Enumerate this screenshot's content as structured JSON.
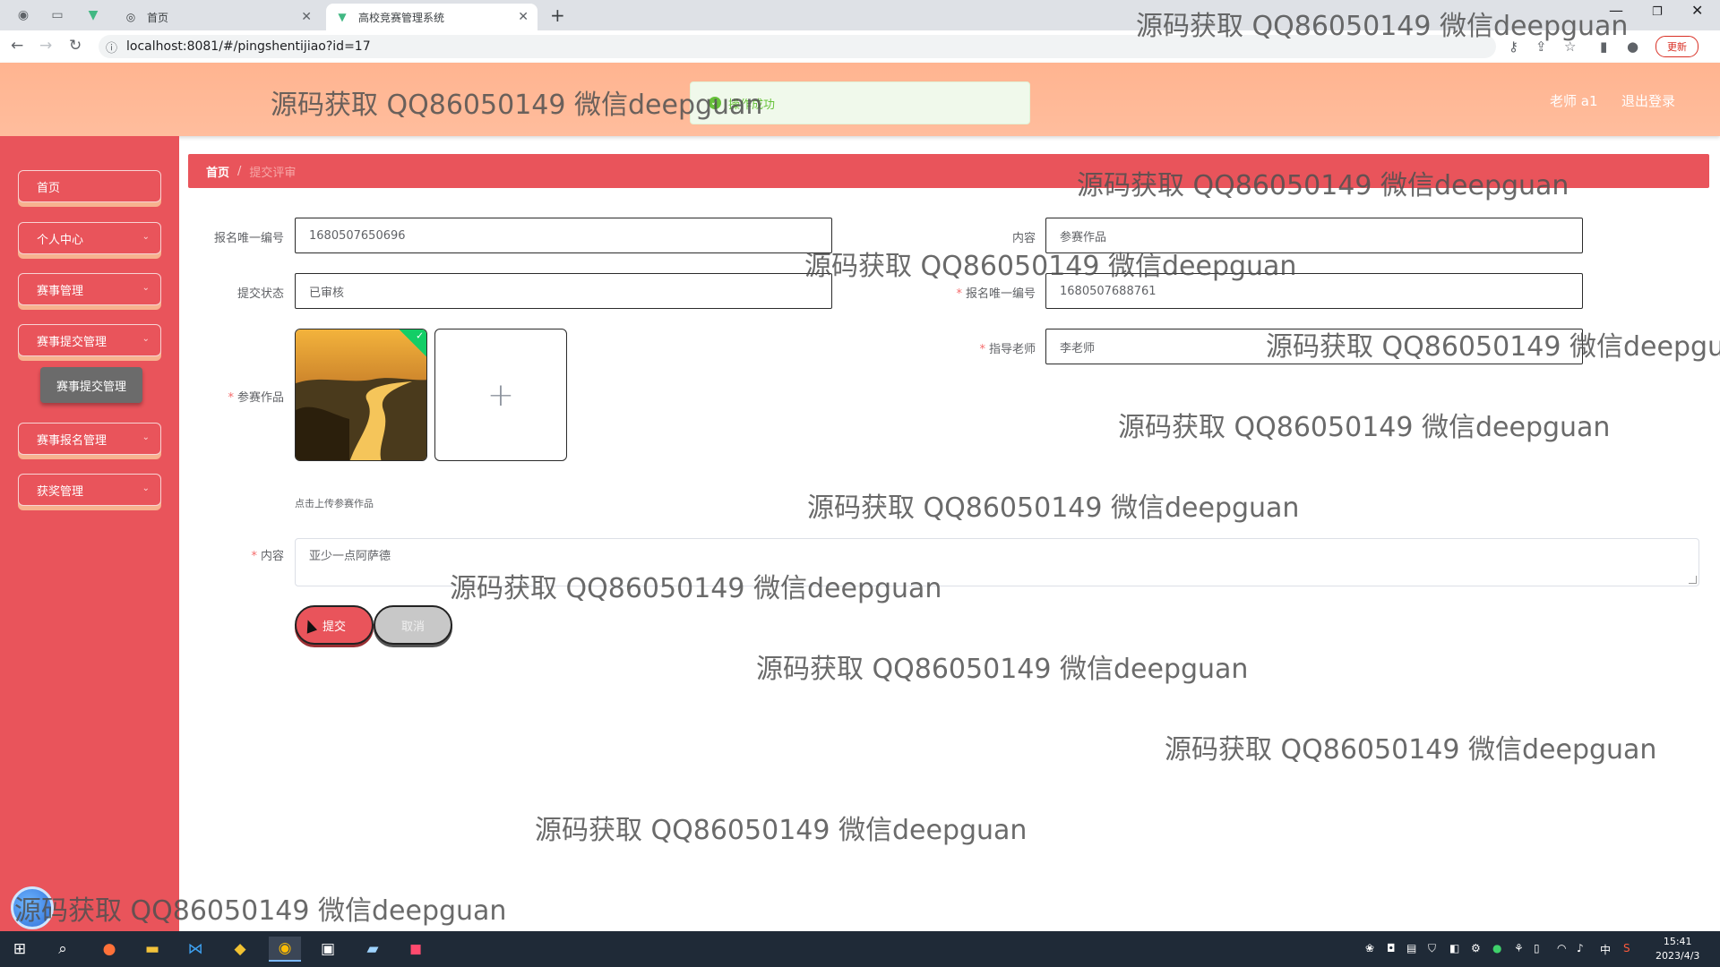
{
  "browser": {
    "tabs": [
      {
        "title": "首页",
        "active": false
      },
      {
        "title": "高校竞赛管理系统",
        "active": true
      }
    ],
    "url": "localhost:8081/#/pingshentijiao?id=17",
    "update_label": "更新"
  },
  "header": {
    "toast": "操作成功",
    "user": "老师 a1",
    "logout": "退出登录"
  },
  "sidebar": {
    "items": [
      {
        "label": "首页",
        "has_chevron": false
      },
      {
        "label": "个人中心",
        "has_chevron": true
      },
      {
        "label": "赛事管理",
        "has_chevron": true
      },
      {
        "label": "赛事提交管理",
        "has_chevron": true
      },
      {
        "label": "赛事报名管理",
        "has_chevron": true
      },
      {
        "label": "获奖管理",
        "has_chevron": true
      }
    ],
    "submenu": "赛事提交管理"
  },
  "breadcrumb": {
    "home": "首页",
    "separator": "/",
    "current": "提交评审"
  },
  "form": {
    "baoming_id": {
      "label": "报名唯一编号",
      "value": "1680507650696"
    },
    "neirong_top": {
      "label": "内容",
      "value": "参赛作品"
    },
    "status": {
      "label": "提交状态",
      "value": "已审核"
    },
    "baoming_id2": {
      "label": "报名唯一编号",
      "value": "1680507688761",
      "required": true
    },
    "teacher": {
      "label": "指导老师",
      "value": "李老师",
      "required": true
    },
    "work": {
      "label": "参赛作品",
      "required": true,
      "upload_tip": "点击上传参赛作品",
      "upload_plus": "+"
    },
    "content": {
      "label": "内容",
      "value": "亚少一点阿萨德",
      "required": true
    },
    "submit": "提交",
    "cancel": "取消"
  },
  "watermark": "源码获取 QQ86050149 微信deepguan",
  "taskbar": {
    "time": "15:41",
    "date": "2023/4/3",
    "ime": "中"
  },
  "colors": {
    "sidebar": "#e9545b",
    "header": "#ffb490",
    "success": "#67c23a"
  }
}
